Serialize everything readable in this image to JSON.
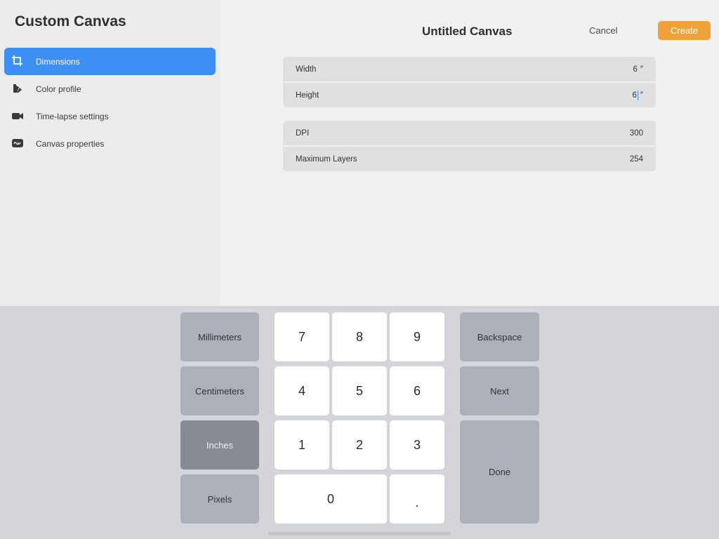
{
  "sidebar": {
    "title": "Custom Canvas",
    "items": [
      {
        "label": "Dimensions",
        "icon": "crop-icon",
        "active": true
      },
      {
        "label": "Color profile",
        "icon": "color-swatch-icon"
      },
      {
        "label": "Time-lapse settings",
        "icon": "video-camera-icon"
      },
      {
        "label": "Canvas properties",
        "icon": "waveform-icon"
      }
    ]
  },
  "header": {
    "title": "Untitled Canvas",
    "cancel_label": "Cancel",
    "create_label": "Create"
  },
  "fields": {
    "width": {
      "label": "Width",
      "value": "6",
      "unit": "″"
    },
    "height": {
      "label": "Height",
      "value": "6",
      "unit": "″"
    },
    "dpi": {
      "label": "DPI",
      "value": "300"
    },
    "max_layers": {
      "label": "Maximum Layers",
      "value": "254"
    }
  },
  "keypad": {
    "units": [
      "Millimeters",
      "Centimeters",
      "Inches",
      "Pixels"
    ],
    "selected_unit": "Inches",
    "digits": [
      "7",
      "8",
      "9",
      "4",
      "5",
      "6",
      "1",
      "2",
      "3",
      "0",
      "."
    ],
    "backspace_label": "Backspace",
    "next_label": "Next",
    "done_label": "Done"
  },
  "colors": {
    "accent": "#3e8ff4",
    "create_button": "#f0a23a",
    "selected_unit": "#878b93"
  }
}
